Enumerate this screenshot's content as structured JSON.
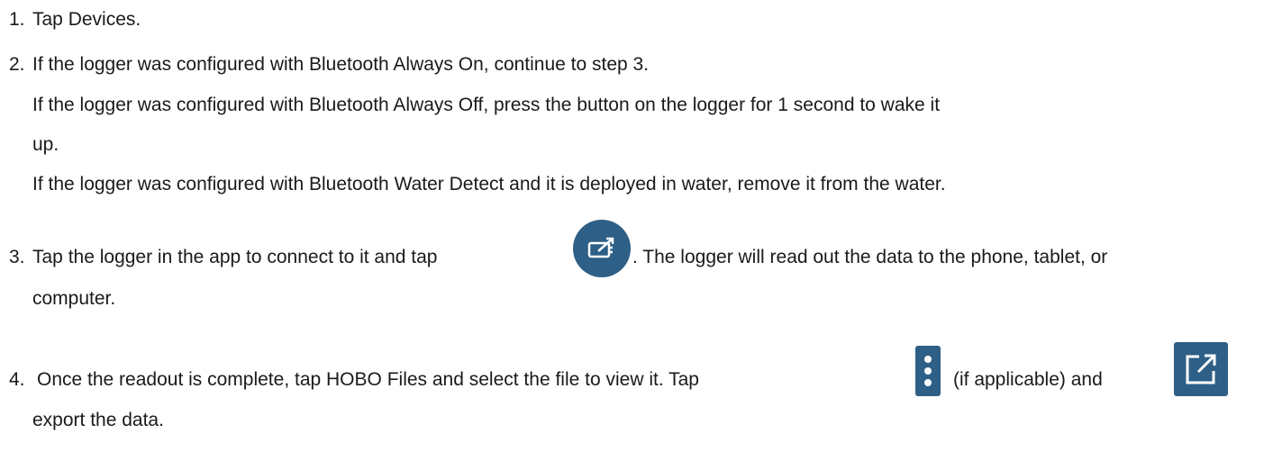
{
  "steps": [
    {
      "number": "1.",
      "text": "Tap Devices."
    },
    {
      "number": "2.",
      "line1": "If the logger was configured with Bluetooth Always On, continue to step 3.",
      "line2": "If the logger was configured with Bluetooth Always Off, press the button on the logger for 1 second to wake it",
      "line3": "up.",
      "line4": "If the logger was configured with Bluetooth Water Detect and it is deployed in water, remove it from the water."
    },
    {
      "number": "3.",
      "text_before_icon": "Tap the logger in the app to connect to it and tap",
      "text_after_icon": ". The logger will read out the data to the phone, tablet, or",
      "line2": "computer.",
      "icon": "readout-icon"
    },
    {
      "number": "4.",
      "text_before_icon": "Once the readout is complete, tap HOBO Files and select the file to view it. Tap",
      "text_between_icons": "(if applicable) and",
      "line2": "export the data.",
      "icon1": "more-options-icon",
      "icon2": "export-icon"
    }
  ],
  "colors": {
    "icon_background": "#2e5f86",
    "icon_foreground": "#ffffff",
    "text": "#1a1a1a"
  }
}
